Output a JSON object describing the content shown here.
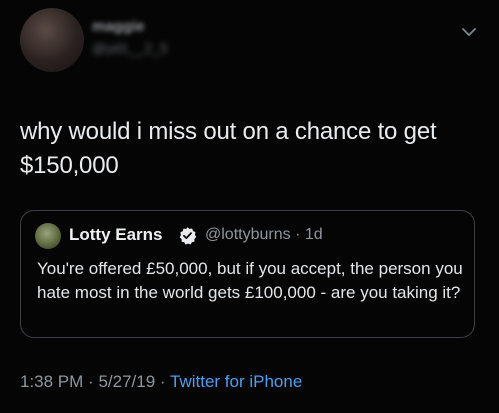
{
  "tweet": {
    "author_name": "maggie",
    "author_handle": "@yd1__2_5",
    "text": "why would i miss out on a chance to get $150,000",
    "time": "1:38 PM",
    "date": "5/27/19",
    "separator": "·",
    "client": "Twitter for iPhone"
  },
  "quoted": {
    "name": "Lotty Earns",
    "handle": "@lottyburns",
    "age": "1d",
    "separator": "·",
    "text": "You're offered £50,000, but if you accept, the person you hate most in the world gets £100,000 - are you taking it?"
  },
  "icons": {
    "verified": "verified-badge-icon",
    "menu": "chevron-down-icon"
  },
  "colors": {
    "background": "#050505",
    "link": "#4a9ff0",
    "muted": "#8d979e",
    "border": "#3a4148"
  }
}
